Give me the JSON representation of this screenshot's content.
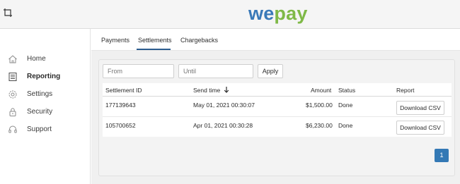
{
  "brand": {
    "logo_we": "we",
    "logo_pay": "pay"
  },
  "header": {
    "crop_icon": "crop-icon"
  },
  "sidebar": {
    "items": [
      {
        "label": "Home",
        "icon": "home-icon",
        "active": false
      },
      {
        "label": "Reporting",
        "icon": "reporting-icon",
        "active": true
      },
      {
        "label": "Settings",
        "icon": "gear-icon",
        "active": false
      },
      {
        "label": "Security",
        "icon": "lock-icon",
        "active": false
      },
      {
        "label": "Support",
        "icon": "headset-icon",
        "active": false
      }
    ]
  },
  "tabs": [
    {
      "label": "Payments",
      "active": false
    },
    {
      "label": "Settlements",
      "active": true
    },
    {
      "label": "Chargebacks",
      "active": false
    }
  ],
  "filters": {
    "from_placeholder": "From",
    "until_placeholder": "Until",
    "apply_label": "Apply"
  },
  "table": {
    "headers": [
      "Settlement ID",
      "Send time",
      "Amount",
      "Status",
      "Report"
    ],
    "sort_icon": "arrow-down-icon",
    "rows": [
      {
        "id": "177139643",
        "send_time": "May 01, 2021 00:30:07",
        "amount": "$1,500.00",
        "status": "Done",
        "report": "Download CSV"
      },
      {
        "id": "105700652",
        "send_time": "Apr 01, 2021 00:30:28",
        "amount": "$6,230.00",
        "status": "Done",
        "report": "Download CSV"
      }
    ]
  },
  "pagination": {
    "current": "1"
  },
  "colors": {
    "brand_blue": "#3a79b8",
    "brand_green": "#7fb947",
    "accent": "#3479b5",
    "tab_underline": "#2c5d8f"
  }
}
